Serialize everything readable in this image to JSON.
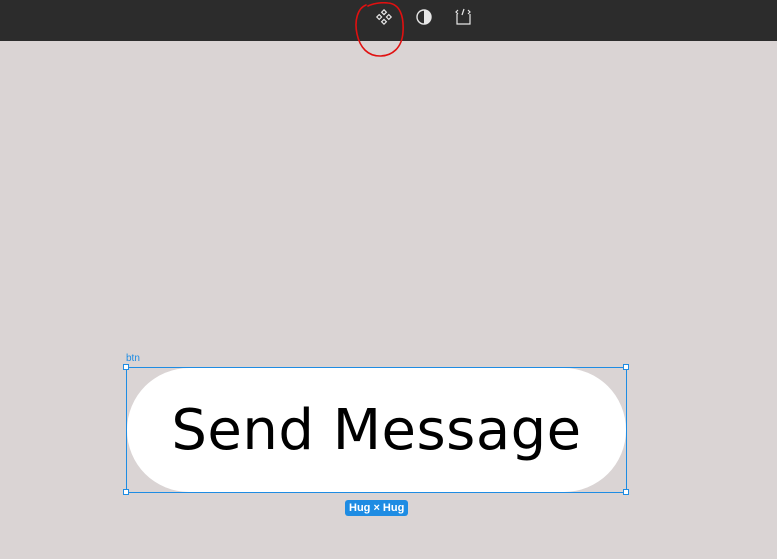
{
  "toolbar": {
    "tools": [
      {
        "icon": "component-icon"
      },
      {
        "icon": "contrast-icon"
      },
      {
        "icon": "dev-mode-icon"
      }
    ]
  },
  "annotation": {
    "color": "#e01010"
  },
  "canvas": {
    "background": "#dad4d4",
    "frame_label": "btn",
    "button": {
      "label": "Send Message",
      "background": "#ffffff",
      "text_color": "#000000"
    },
    "selection": {
      "color": "#1e8ce3",
      "size_badge": "Hug × Hug"
    }
  }
}
